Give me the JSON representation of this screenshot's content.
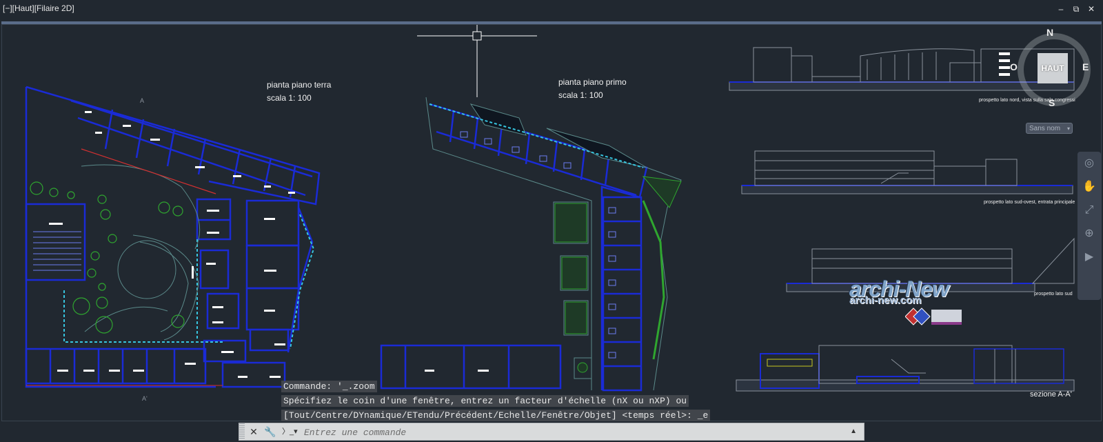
{
  "viewport": {
    "label": "[−][Haut][Filaire 2D]"
  },
  "window_controls": {
    "minimize": "–",
    "restore": "⧉",
    "close": "✕"
  },
  "drawings": {
    "ground_floor": {
      "title": "pianta piano terra",
      "scale": "scala 1: 100"
    },
    "first_floor": {
      "title": "pianta piano primo",
      "scale": "scala 1: 100"
    }
  },
  "elevations": [
    {
      "caption": "prospetto lato nord, vista sulla sala congressi"
    },
    {
      "caption": "prospetto lato sud-ovest, entrata principale"
    },
    {
      "caption": "prospetto lato sud"
    }
  ],
  "section": {
    "caption": "sezione A-A'"
  },
  "section_marks": {
    "top": "A",
    "bottom": "A'"
  },
  "viewcube": {
    "face": "HAUT",
    "north": "N",
    "south": "S",
    "east": "E",
    "west": "O"
  },
  "wcs_menu": {
    "label": "Sans nom"
  },
  "watermark": {
    "brand": "archi-New",
    "site": "archi-new.com"
  },
  "command_history": [
    "Commande: '_.zoom",
    "Spécifiez le coin d'une fenêtre, entrez un facteur d'échelle (nX ou nXP) ou",
    "[Tout/Centre/DYnamique/ETendu/Précédent/Echelle/Fenêtre/Objet] <temps réel>: _e"
  ],
  "command_line": {
    "placeholder": "Entrez une commande"
  },
  "icons": {
    "close": "close-icon",
    "customize": "wrench-icon",
    "prompt": "command-prompt-icon",
    "history": "chevron-up-icon"
  },
  "colors": {
    "background": "#212830",
    "wall": "#1a2bd6",
    "accent_cyan": "#37c6e0",
    "accent_green": "#2fa62f"
  }
}
